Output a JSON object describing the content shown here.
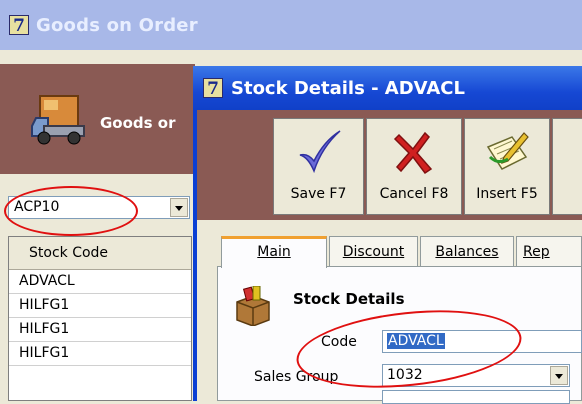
{
  "back_window": {
    "icon_glyph": "7",
    "title": "Goods on Order",
    "banner_text": "Goods or",
    "stock_combo_value": "ACP10",
    "grid": {
      "header": "Stock Code",
      "rows": [
        "ADVACL",
        "HILFG1",
        "HILFG1",
        "HILFG1"
      ]
    }
  },
  "front_window": {
    "icon_glyph": "7",
    "title": "Stock Details - ADVACL",
    "toolbar": {
      "save_label": "Save F7",
      "cancel_label": "Cancel F8",
      "insert_label": "Insert F5"
    },
    "tabs": [
      {
        "label": "Main",
        "active": true
      },
      {
        "label": "Discount",
        "active": false
      },
      {
        "label": "Balances",
        "active": false
      },
      {
        "label": "Rep",
        "active": false
      }
    ],
    "section_title": "Stock Details",
    "fields": {
      "code_label": "Code",
      "code_value": "ADVACL",
      "sales_group_label": "Sales Group",
      "sales_group_value": "1032"
    }
  },
  "colors": {
    "annotation": "#e01010",
    "title_active": "#1648d4",
    "title_inactive": "#a8b8e8",
    "banner": "#8a5a54"
  }
}
